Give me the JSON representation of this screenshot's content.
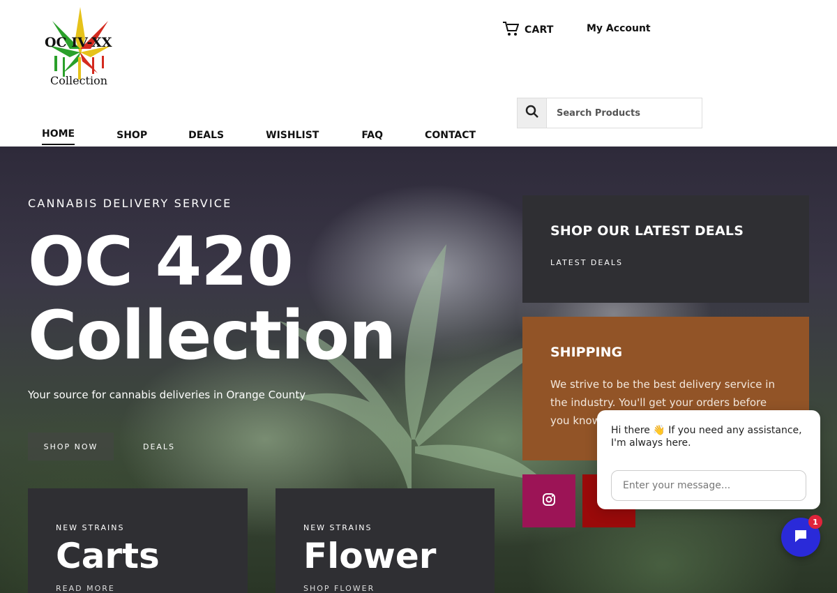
{
  "header": {
    "logo_text_top": "OC IV-XX",
    "logo_text_bottom": "Collection",
    "cart_label": "CART",
    "account_label": "My Account",
    "search_placeholder": "Search Products"
  },
  "nav": {
    "items": [
      {
        "label": "HOME",
        "active": true
      },
      {
        "label": "SHOP"
      },
      {
        "label": "DEALS"
      },
      {
        "label": "WISHLIST"
      },
      {
        "label": "FAQ"
      },
      {
        "label": "CONTACT"
      }
    ]
  },
  "hero": {
    "kicker": "CANNABIS DELIVERY SERVICE",
    "title_line1": "OC 420",
    "title_line2": "Collection",
    "subtitle": "Your source for cannabis deliveries in Orange County",
    "btn_shop": "SHOP NOW",
    "btn_deals": "DEALS"
  },
  "cards": [
    {
      "kicker": "NEW STRAINS",
      "title": "Carts",
      "link": "READ MORE"
    },
    {
      "kicker": "NEW STRAINS",
      "title": "Flower",
      "link": "SHOP FLOWER"
    }
  ],
  "deals_box": {
    "title": "SHOP OUR LATEST DEALS",
    "link": "LATEST DEALS"
  },
  "shipping_box": {
    "title": "SHIPPING",
    "text": "We strive to be the best delivery service in the industry. You'll get your orders before you know it."
  },
  "chat": {
    "greeting_start": "Hi there",
    "greeting_emoji": "👋",
    "greeting_end": "If you need any assistance, I'm always here.",
    "input_placeholder": "Enter your message...",
    "badge_count": "1"
  },
  "colors": {
    "accent_brown": "#925427",
    "dark_panel": "#2f2f33",
    "instagram": "#9c1456",
    "social_red": "#9a0a0a",
    "chat_blue": "#2a2ad9"
  },
  "icons": [
    "cart-icon",
    "search-icon",
    "instagram-icon",
    "chat-icon"
  ]
}
